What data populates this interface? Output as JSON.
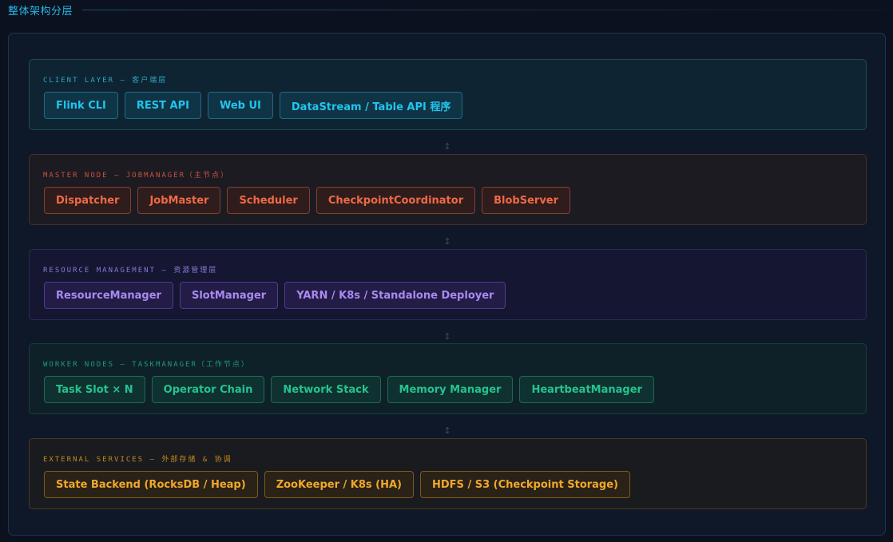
{
  "section": {
    "title": "整体架构分层"
  },
  "connector_glyph": "↕",
  "layers": [
    {
      "title": "CLIENT LAYER — 客户端层",
      "color": "#22c4ec",
      "chips": [
        "Flink CLI",
        "REST API",
        "Web UI",
        "DataStream / Table API 程序"
      ]
    },
    {
      "title": "MASTER NODE — JOBMANAGER（主节点）",
      "color": "#ef6a45",
      "chips": [
        "Dispatcher",
        "JobMaster",
        "Scheduler",
        "CheckpointCoordinator",
        "BlobServer"
      ]
    },
    {
      "title": "RESOURCE MANAGEMENT — 资源管理层",
      "color": "#a88af0",
      "chips": [
        "ResourceManager",
        "SlotManager",
        "YARN / K8s / Standalone Deployer"
      ]
    },
    {
      "title": "WORKER NODES — TASKMANAGER（工作节点）",
      "color": "#25c38e",
      "chips": [
        "Task Slot × N",
        "Operator Chain",
        "Network Stack",
        "Memory Manager",
        "HeartbeatManager"
      ]
    },
    {
      "title": "EXTERNAL SERVICES — 外部存储 & 协调",
      "color": "#f0a82a",
      "chips": [
        "State Backend (RocksDB / Heap)",
        "ZooKeeper / K8s (HA)",
        "HDFS / S3 (Checkpoint Storage)"
      ]
    }
  ]
}
